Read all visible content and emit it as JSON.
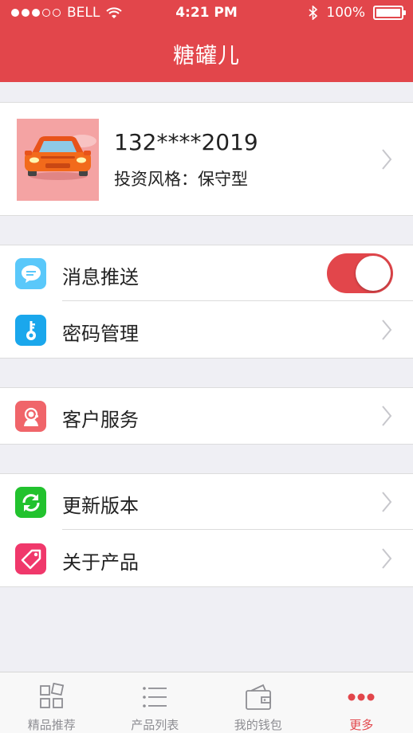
{
  "status_bar": {
    "carrier": "BELL",
    "time": "4:21 PM",
    "battery": "100%"
  },
  "header": {
    "title": "糖罐儿"
  },
  "profile": {
    "phone": "132****2019",
    "invest_style": "投资风格：保守型"
  },
  "settings": {
    "push": {
      "label": "消息推送",
      "enabled": true
    },
    "password": {
      "label": "密码管理"
    },
    "service": {
      "label": "客户服务"
    },
    "update": {
      "label": "更新版本"
    },
    "about": {
      "label": "关于产品"
    }
  },
  "tabbar": {
    "tabs": [
      {
        "label": "精品推荐",
        "icon": "grid-icon"
      },
      {
        "label": "产品列表",
        "icon": "list-icon"
      },
      {
        "label": "我的钱包",
        "icon": "wallet-icon"
      },
      {
        "label": "更多",
        "icon": "more-icon",
        "active": true
      }
    ]
  },
  "colors": {
    "accent": "#e2464b",
    "message_icon": "#5ac8fa",
    "password_icon": "#1aa7ec",
    "service_icon": "#f0656a",
    "update_icon": "#22c22e",
    "about_icon": "#f0386b"
  }
}
